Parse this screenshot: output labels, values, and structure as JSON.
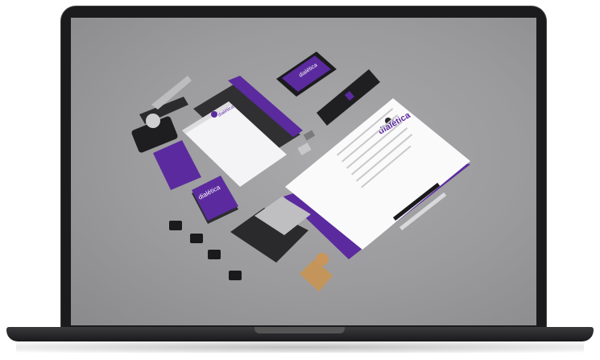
{
  "brand": {
    "logo_text": "dialética",
    "accent_color": "#5b2a9e",
    "dark_color": "#2a2a2c"
  },
  "scene": {
    "objects": [
      "embosser-stamp",
      "envelope",
      "folder",
      "smartphone",
      "pen-holder",
      "letterhead",
      "business-cards",
      "binder-clips",
      "ink-pad",
      "rubber-stamp",
      "pens"
    ]
  }
}
